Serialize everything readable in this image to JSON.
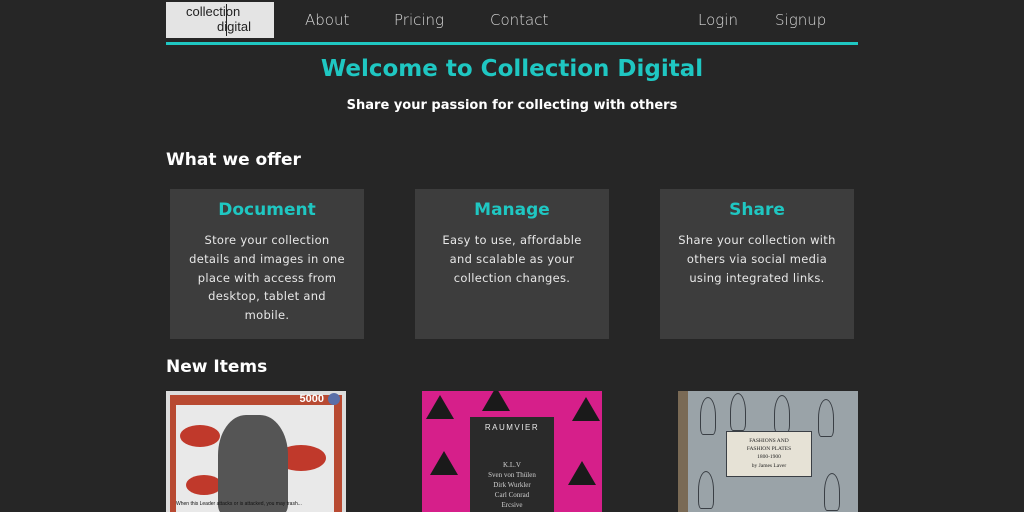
{
  "logo": {
    "line1": "collection",
    "line2": "digital"
  },
  "nav": {
    "links": [
      {
        "label": "About"
      },
      {
        "label": "Pricing"
      },
      {
        "label": "Contact"
      }
    ],
    "login_label": "Login",
    "signup_label": "Signup"
  },
  "hero": {
    "title": "Welcome to Collection Digital",
    "subtitle": "Share your passion for collecting with others"
  },
  "offer": {
    "heading": "What we offer",
    "cards": [
      {
        "title": "Document",
        "text": "Store your collection details and images in one place with access from desktop, tablet and mobile."
      },
      {
        "title": "Manage",
        "text": "Easy to use, affordable and scalable as your collection changes."
      },
      {
        "title": "Share",
        "text": "Share your collection with others via social media using integrated links."
      }
    ]
  },
  "new_items": {
    "heading": "New Items",
    "items": [
      {
        "number": "5000",
        "caption": "When this Leader attacks or is attacked, you may trash..."
      },
      {
        "title": "RAUMVIER",
        "lines": [
          "K.L.V",
          "Sven von Thülen",
          "Dirk Wurkler",
          "Carl Conrad",
          "Ercsive"
        ]
      },
      {
        "plate_lines": [
          "FASHIONS AND",
          "FASHION PLATES",
          "1800-1900",
          "by James Laver"
        ]
      }
    ]
  },
  "colors": {
    "accent": "#1fc7c2",
    "background": "#262626",
    "card": "#3d3d3d"
  }
}
